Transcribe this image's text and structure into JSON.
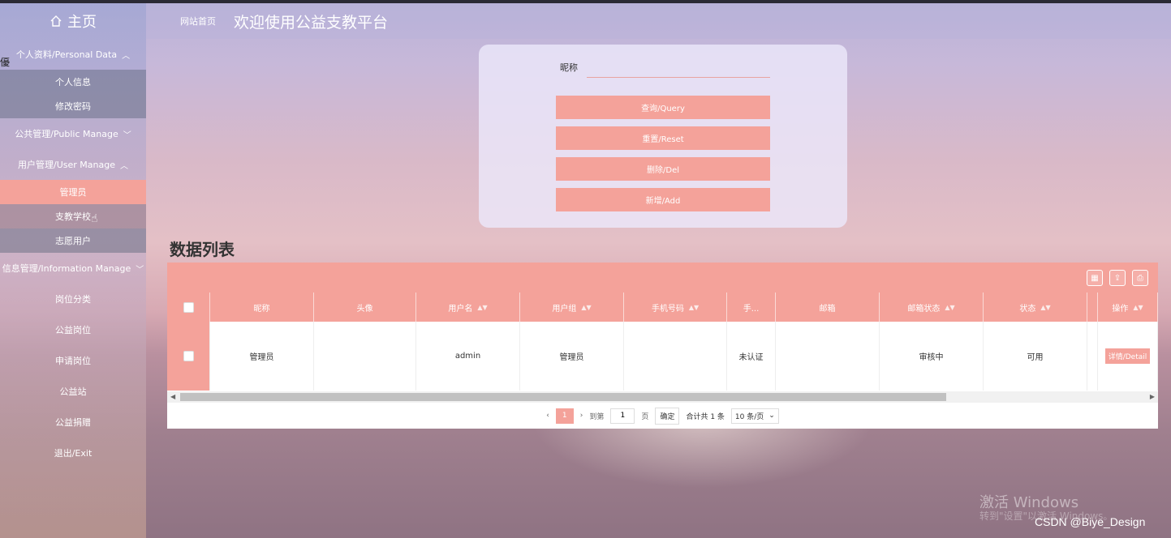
{
  "sidebar": {
    "home_label": "主页",
    "edge_char": "優",
    "groups": {
      "personal": "个人资料/Personal Data",
      "public": "公共管理/Public Manage",
      "user": "用户管理/User Manage",
      "info": "信息管理/Information Manage"
    },
    "items": {
      "profile": "个人信息",
      "password": "修改密码",
      "admin": "管理员",
      "school": "支教学校",
      "volunteer": "志愿用户",
      "category": "岗位分类",
      "post": "公益岗位",
      "apply": "申请岗位",
      "station": "公益站",
      "donation": "公益捐赠",
      "exit": "退出/Exit"
    }
  },
  "header": {
    "breadcrumb": "网站首页",
    "title": "欢迎使用公益支教平台"
  },
  "search": {
    "nickname_label": "昵称",
    "nickname_value": "",
    "buttons": {
      "query": "查询/Query",
      "reset": "重置/Reset",
      "delete": "删除/Del",
      "add": "新增/Add"
    }
  },
  "list_title": "数据列表",
  "table": {
    "columns": {
      "nickname": "昵称",
      "avatar": "头像",
      "username": "用户名",
      "group": "用户组",
      "phone": "手机号码",
      "phone_status": "手...",
      "email": "邮箱",
      "email_status": "邮箱状态",
      "status": "状态",
      "action": "操作"
    },
    "row": {
      "nickname": "管理员",
      "avatar": "",
      "username": "admin",
      "group": "管理员",
      "phone": "",
      "phone_status": "未认证",
      "email": "",
      "email_status": "审核中",
      "status": "可用",
      "detail": "详情/Detail"
    }
  },
  "pager": {
    "current": "1",
    "goto_label": "到第",
    "goto_value": "1",
    "page_unit": "页",
    "confirm": "确定",
    "total": "合计共 1 条",
    "page_size": "10 条/页"
  },
  "watermark": {
    "line1": "激活 Windows",
    "line2": "转到\"设置\"以激活 Windows。",
    "csdn": "CSDN @Biye_Design"
  },
  "colors": {
    "accent": "#f4a29a",
    "sidebar_active": "#f4a29a"
  }
}
